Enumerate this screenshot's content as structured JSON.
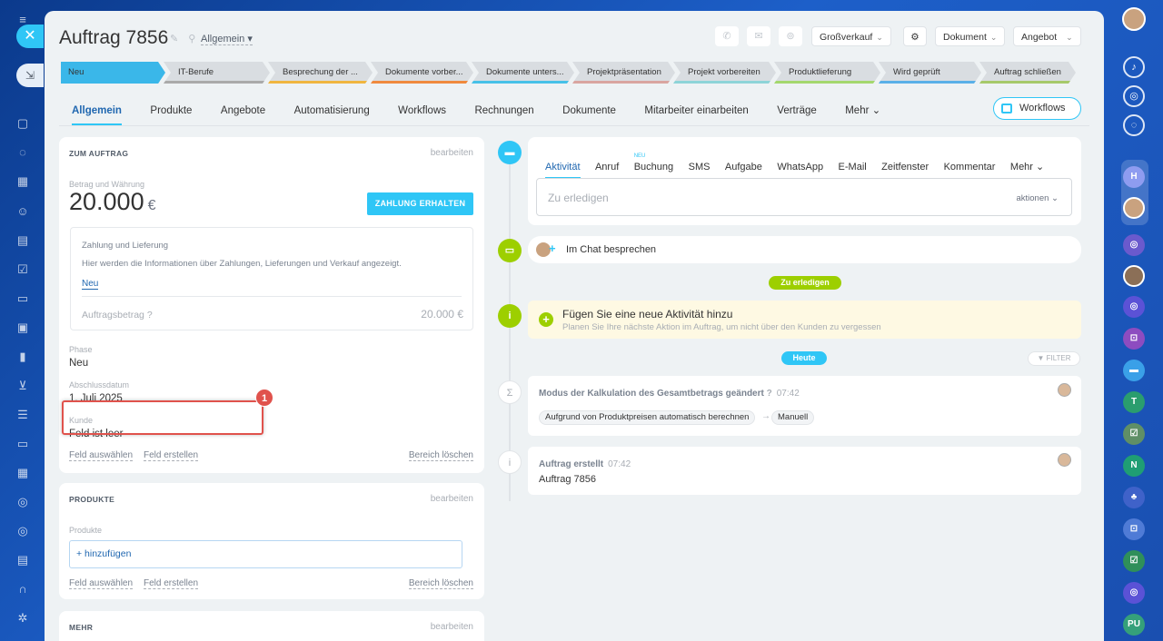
{
  "deal": {
    "title": "Auftrag 7856",
    "mode": "Allgemein"
  },
  "toolbar": {
    "category": "Großverkauf",
    "document": "Dokument",
    "offer": "Angebot"
  },
  "stages": [
    "Neu",
    "IT-Berufe",
    "Besprechung der ...",
    "Dokumente vorber...",
    "Dokumente unters...",
    "Projektpräsentation",
    "Projekt vorbereiten",
    "Produktlieferung",
    "Wird geprüft",
    "Auftrag schließen"
  ],
  "stage_colors": [
    "#3ab7e9",
    "#aaaaaa",
    "#f0b640",
    "#f08a3e",
    "#47c1e8",
    "#d9a5a0",
    "#8ed4d8",
    "#a4d86e",
    "#5ab0e8",
    "#a6c96a"
  ],
  "tabs": [
    "Allgemein",
    "Produkte",
    "Angebote",
    "Automatisierung",
    "Workflows",
    "Rechnungen",
    "Dokumente",
    "Mitarbeiter einarbeiten",
    "Verträge",
    "Mehr"
  ],
  "workflows_button": "Workflows",
  "about": {
    "header": "ZUM AUFTRAG",
    "edit": "bearbeiten",
    "amount_label": "Betrag und Währung",
    "amount": "20.000",
    "currency": "€",
    "pay_button": "ZAHLUNG ERHALTEN",
    "payment_title": "Zahlung und Lieferung",
    "payment_info": "Hier werden die Informationen über Zahlungen, Lieferungen und Verkauf angezeigt.",
    "payment_link": "Neu",
    "order_amount_label": "Auftragsbetrag",
    "order_amount": "20.000 €",
    "phase_label": "Phase",
    "phase_value": "Neu",
    "close_label": "Abschlussdatum",
    "close_value": "1. Juli 2025",
    "customer_label": "Kunde",
    "customer_value": "Feld ist leer",
    "select_field": "Feld auswählen",
    "create_field": "Feld erstellen",
    "delete_section": "Bereich löschen",
    "badge": "1"
  },
  "products": {
    "header": "PRODUKTE",
    "edit": "bearbeiten",
    "label": "Produkte",
    "add": "+ hinzufügen",
    "select_field": "Feld auswählen",
    "create_field": "Feld erstellen",
    "delete_section": "Bereich löschen"
  },
  "more": {
    "header": "MEHR",
    "edit": "bearbeiten"
  },
  "activity": {
    "tabs": [
      "Aktivität",
      "Anruf",
      "Buchung",
      "SMS",
      "Aufgabe",
      "WhatsApp",
      "E-Mail",
      "Zeitfenster",
      "Kommentar",
      "Mehr"
    ],
    "new_badge": "NEU",
    "todo_placeholder": "Zu erledigen",
    "actions": "aktionen",
    "chat": "Im Chat besprechen",
    "todo_pill": "Zu erledigen",
    "hint_title": "Fügen Sie eine neue Aktivität hinzu",
    "hint_text": "Planen Sie Ihre nächste Aktion im Auftrag, um nicht über den Kunden zu vergessen",
    "today_pill": "Heute",
    "filter": "FILTER"
  },
  "events": [
    {
      "title": "Modus der Kalkulation des Gesamtbetrags geändert",
      "time": "07:42",
      "from": "Aufgrund von Produktpreisen automatisch berechnen",
      "to": "Manuell"
    },
    {
      "title": "Auftrag erstellt",
      "time": "07:42",
      "body": "Auftrag 7856"
    }
  ],
  "right_rail": {
    "initials_1": "T",
    "initials_2": "N",
    "initials_3": "PU"
  }
}
